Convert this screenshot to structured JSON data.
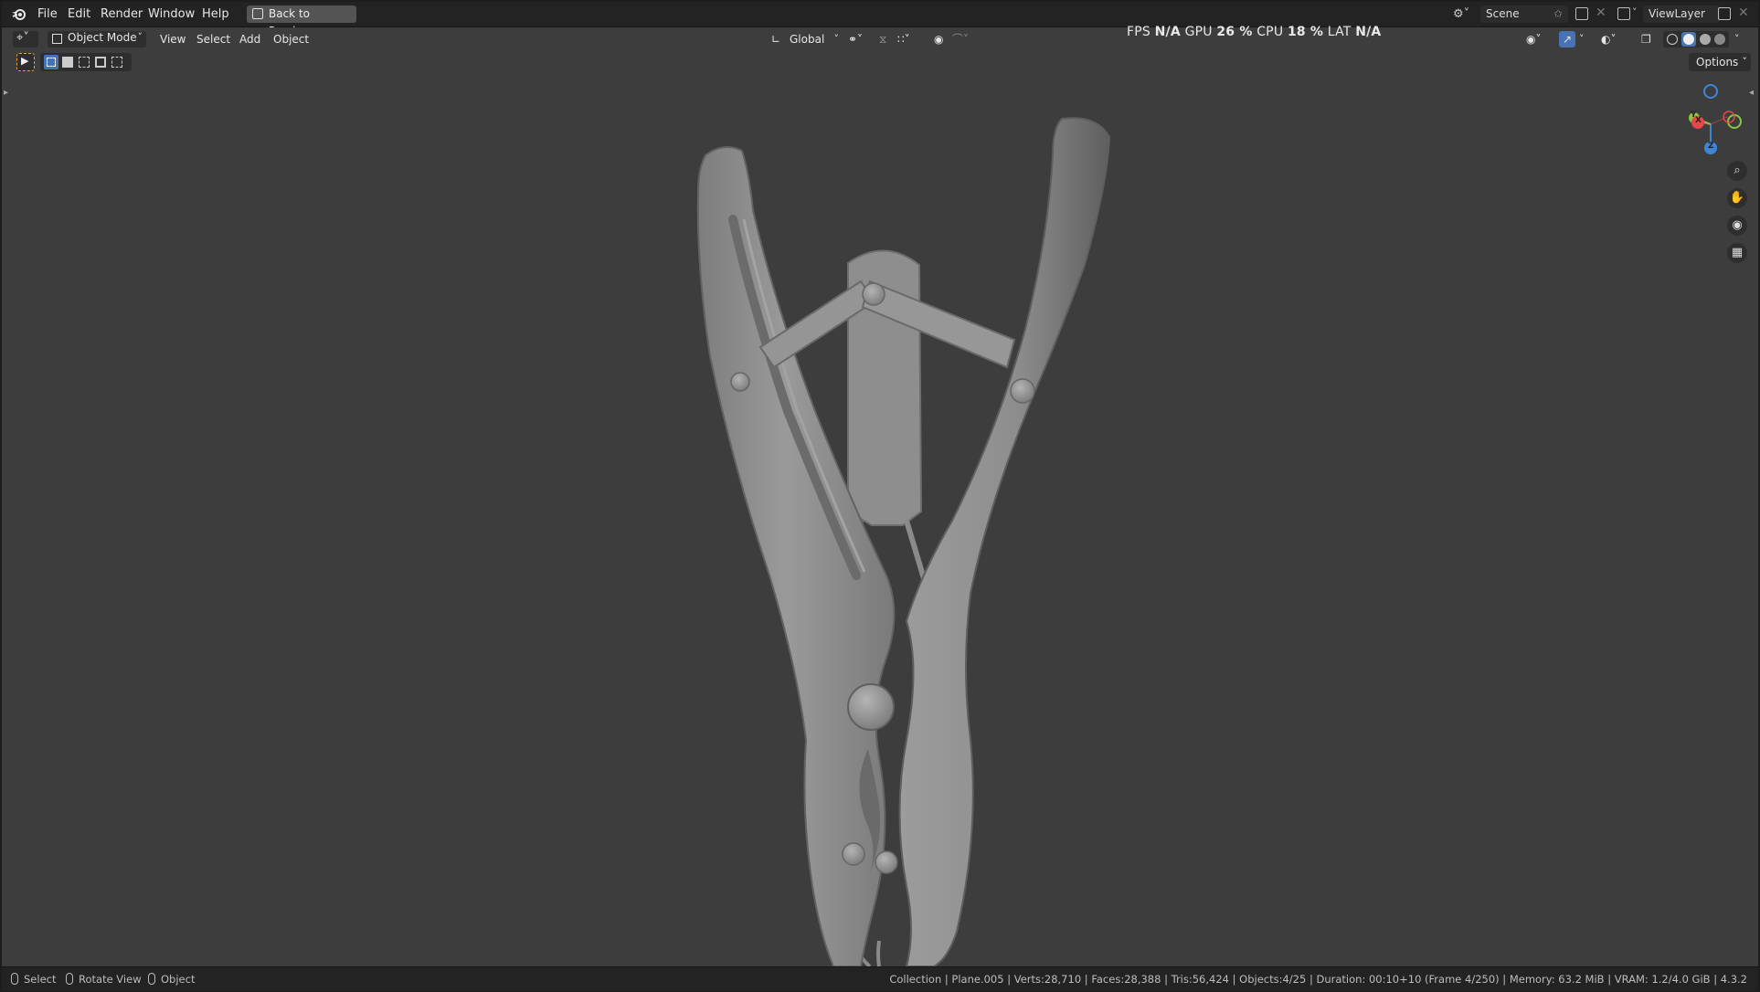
{
  "menu": {
    "file": "File",
    "edit": "Edit",
    "render": "Render",
    "window": "Window",
    "help": "Help",
    "back_to_previous": "Back to Previous"
  },
  "scene": {
    "name": "Scene"
  },
  "view_layer": {
    "name": "ViewLayer"
  },
  "header": {
    "mode": "Object Mode",
    "view": "View",
    "select": "Select",
    "add": "Add",
    "object": "Object",
    "transform_orientation": "Global",
    "options": "Options"
  },
  "stats": {
    "fps_label": "FPS",
    "fps_value": "N/A",
    "gpu_label": "GPU",
    "gpu_value": "26 %",
    "cpu_label": "CPU",
    "cpu_value": "18 %",
    "lat_label": "LAT",
    "lat_value": "N/A"
  },
  "gizmo": {
    "x": "X",
    "y": "Y",
    "z": "Z"
  },
  "statusbar": {
    "select": "Select",
    "rotate_view": "Rotate View",
    "object": "Object",
    "info": "Collection | Plane.005 | Verts:28,710 | Faces:28,388 | Tris:56,424 | Objects:4/25 | Duration: 00:10+10 (Frame 4/250) | Memory: 63.2 MiB | VRAM: 1.2/4.0 GiB | 4.3.2"
  },
  "icons": {
    "logo": "blender-logo-icon",
    "editor_type": "3d-viewport-icon",
    "select_tool": "select-box-icon",
    "zoom": "zoom-icon",
    "pan": "hand-icon",
    "camera": "camera-icon",
    "ortho": "grid-icon"
  },
  "colors": {
    "viewport_bg": "#3d3d3d",
    "header_bg": "#232323",
    "model": "#8f8f8f",
    "accent_blue": "#4772b3",
    "axis_x": "#e5474b",
    "axis_y": "#8bc43f",
    "axis_z": "#3c86d8"
  }
}
